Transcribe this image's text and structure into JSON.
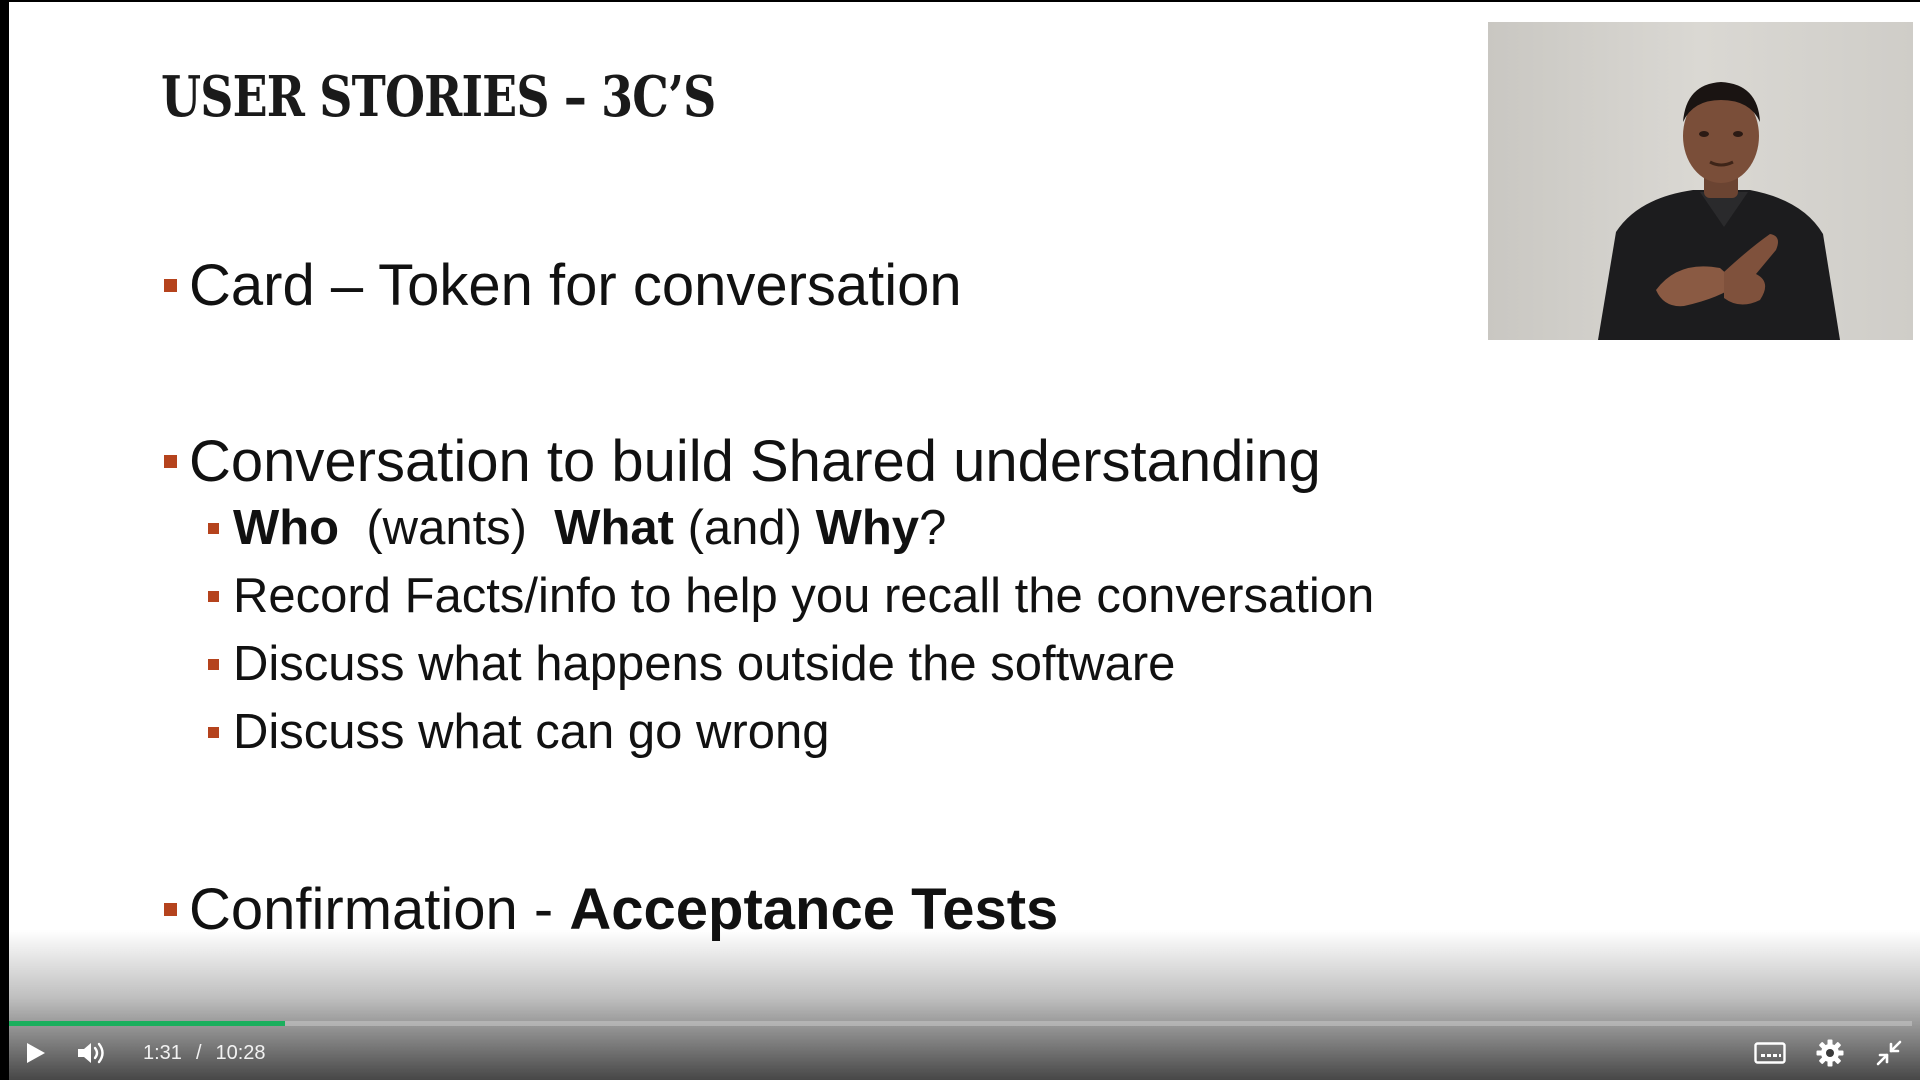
{
  "slide": {
    "title": "USER STORIES – 3C’S",
    "bullets": {
      "card": "Card – Token for conversation",
      "conversation": "Conversation to build Shared understanding",
      "sub1": {
        "who": "Who",
        "wants": "(wants)",
        "what": "What",
        "and": "(and)",
        "why": "Why",
        "q": "?"
      },
      "sub2": "Record Facts/info to help you recall the conversation",
      "sub3": "Discuss what happens outside the software",
      "sub4": "Discuss what can go wrong",
      "confirmation_prefix": "Confirmation -",
      "confirmation_bold": "Acceptance Tests"
    },
    "marker_color": "#b5431d"
  },
  "player": {
    "current_time": "1:31",
    "separator": "/",
    "duration": "10:28",
    "progress_fraction": 0.145,
    "progress_color": "#1aaf5d",
    "icons": {
      "play": "play-icon",
      "volume": "volume-icon",
      "captions": "captions-icon",
      "settings": "gear-icon",
      "exit_fullscreen": "exit-fullscreen-icon"
    }
  }
}
